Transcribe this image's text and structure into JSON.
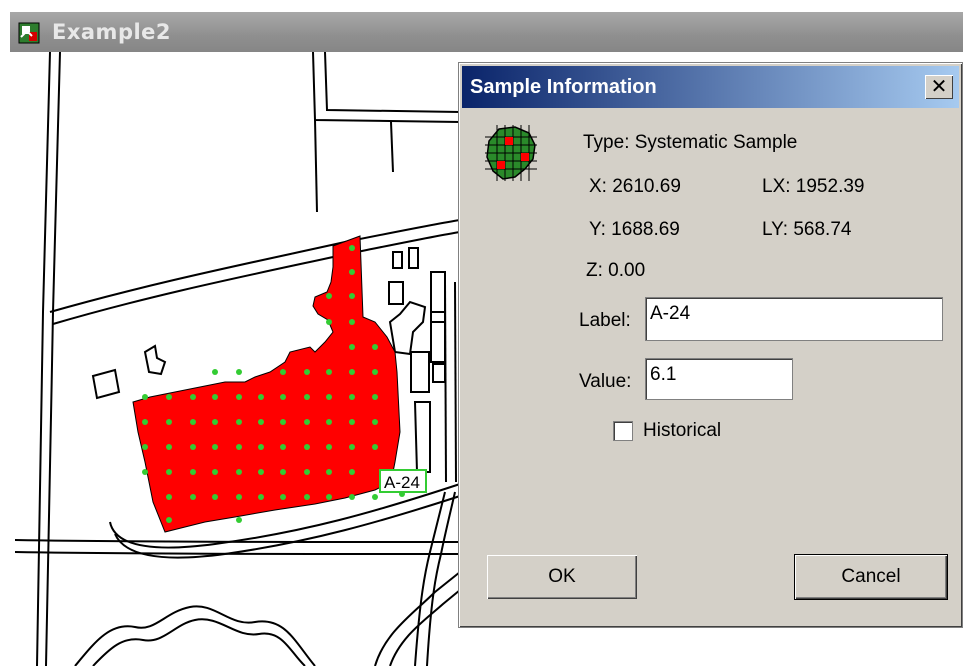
{
  "window": {
    "title": "Example2"
  },
  "map": {
    "sample_label": "A-24"
  },
  "dialog": {
    "title": "Sample Information",
    "close_glyph": "✕",
    "type_text": "Type: Systematic Sample",
    "x_text": "X: 2610.69",
    "lx_text": "LX: 1952.39",
    "y_text": "Y: 1688.69",
    "ly_text": "LY: 568.74",
    "z_text": "Z: 0.00",
    "label_caption": "Label:",
    "label_value": "A-24",
    "value_caption": "Value:",
    "value_value": "6.1",
    "historical_caption": "Historical",
    "historical_checked": false,
    "ok_label": "OK",
    "cancel_label": "Cancel"
  },
  "colors": {
    "sample_area": "#ff0000",
    "sample_point": "#33cc33",
    "dialog_face": "#d4d0c8",
    "title_active": "#0a246a"
  }
}
